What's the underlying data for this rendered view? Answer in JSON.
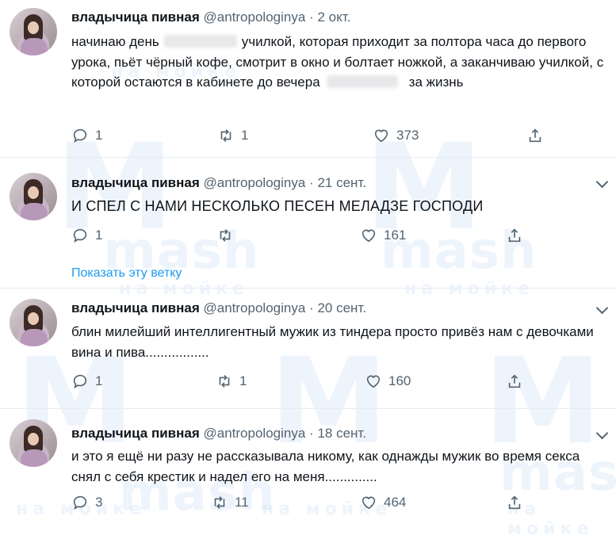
{
  "watermark": {
    "letter": "M",
    "brand": "mash",
    "sub": "на мойке"
  },
  "tweets": [
    {
      "name": "владычица пивная",
      "handle": "@antropologinya",
      "sep": "·",
      "date": "2 окт.",
      "text_parts": [
        "начинаю день",
        "училкой, которая приходит за полтора часа до первого урока, пьёт чёрный кофе, смотрит в окно и болтает ножкой, а заканчиваю училкой, с которой остаются в кабинете до вечера",
        "за жизнь"
      ],
      "replies": "1",
      "retweets": "1",
      "likes": "373"
    },
    {
      "name": "владычица пивная",
      "handle": "@antropologinya",
      "sep": "·",
      "date": "21 сент.",
      "text": "И СПЕЛ С НАМИ НЕСКОЛЬКО ПЕСЕН МЕЛАДЗЕ ГОСПОДИ",
      "replies": "1",
      "retweets": "",
      "likes": "161",
      "show_thread": "Показать эту ветку"
    },
    {
      "name": "владычица пивная",
      "handle": "@antropologinya",
      "sep": "·",
      "date": "20 сент.",
      "text": "блин милейший интеллигентный мужик из тиндера просто привёз нам с девочками вина и пива.................",
      "replies": "1",
      "retweets": "1",
      "likes": "160"
    },
    {
      "name": "владычица пивная",
      "handle": "@antropologinya",
      "sep": "·",
      "date": "18 сент.",
      "text": "и это я ещё ни разу не рассказывала никому, как однажды мужик во время секса снял с себя крестик и надел его на меня..............",
      "replies": "3",
      "retweets": "11",
      "likes": "464"
    }
  ]
}
